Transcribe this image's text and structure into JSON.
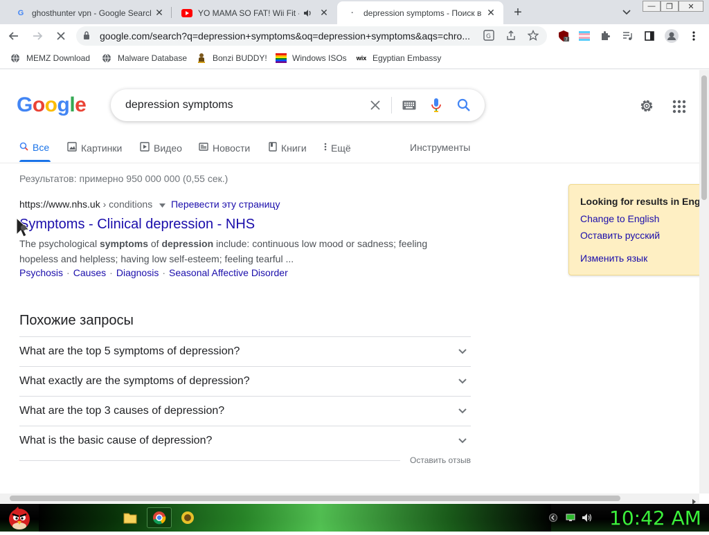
{
  "tabs": [
    {
      "title": "ghosthunter vpn - Google Search",
      "favicon": "google-icon",
      "active": false
    },
    {
      "title": "YO MAMA SO FAT! Wii Fit - YouTube",
      "favicon": "youtube-icon",
      "active": false
    },
    {
      "title": "depression symptoms - Поиск в Google",
      "favicon": "loading-icon",
      "active": true
    }
  ],
  "new_tab_symbol": "+",
  "toolbar": {
    "url": "google.com/search?q=depression+symptoms&oq=depression+symptoms&aqs=chro..."
  },
  "bookmarks": [
    {
      "label": "MEMZ Download",
      "icon": "globe-icon"
    },
    {
      "label": "Malware Database",
      "icon": "globe-icon"
    },
    {
      "label": "Bonzi BUDDY!",
      "icon": "bonzi-icon"
    },
    {
      "label": "Windows ISOs",
      "icon": "windows-flag-icon"
    },
    {
      "label": "Egyptian Embassy",
      "icon": "wix-icon"
    }
  ],
  "search": {
    "logo": "Google",
    "query": "depression symptoms",
    "nav": [
      "Все",
      "Картинки",
      "Видео",
      "Новости",
      "Книги",
      "Ещё"
    ],
    "tools": "Инструменты",
    "stats": "Результатов: примерно 950 000 000 (0,55 сек.)"
  },
  "result": {
    "cite_url": "https://www.nhs.uk",
    "cite_path": "› conditions",
    "translate": "Перевести эту страницу",
    "title": "Symptoms - Clinical depression - NHS",
    "snippet_1": "The psychological ",
    "snippet_b1": "symptoms",
    "snippet_2": " of ",
    "snippet_b2": "depression",
    "snippet_3": " include: continuous low mood or sadness; feeling hopeless and helpless; having low self-esteem; feeling tearful ...",
    "sitelinks": [
      "Psychosis",
      "Causes",
      "Diagnosis",
      "Seasonal Affective Disorder"
    ]
  },
  "related": {
    "heading": "Похожие запросы",
    "questions": [
      "What are the top 5 symptoms of depression?",
      "What exactly are the symptoms of depression?",
      "What are the top 3 causes of depression?",
      "What is the basic cause of depression?"
    ],
    "feedback": "Оставить отзыв"
  },
  "lang_panel": {
    "title": "Looking for results in English?",
    "change_to_english": "Change to English",
    "keep_russian": "Оставить русский",
    "change_language": "Изменить язык"
  },
  "taskbar": {
    "clock": "10:42 AM"
  },
  "colors": {
    "link": "#1a0dab",
    "accent": "#1a73e8",
    "clock": "#3bef3b"
  }
}
